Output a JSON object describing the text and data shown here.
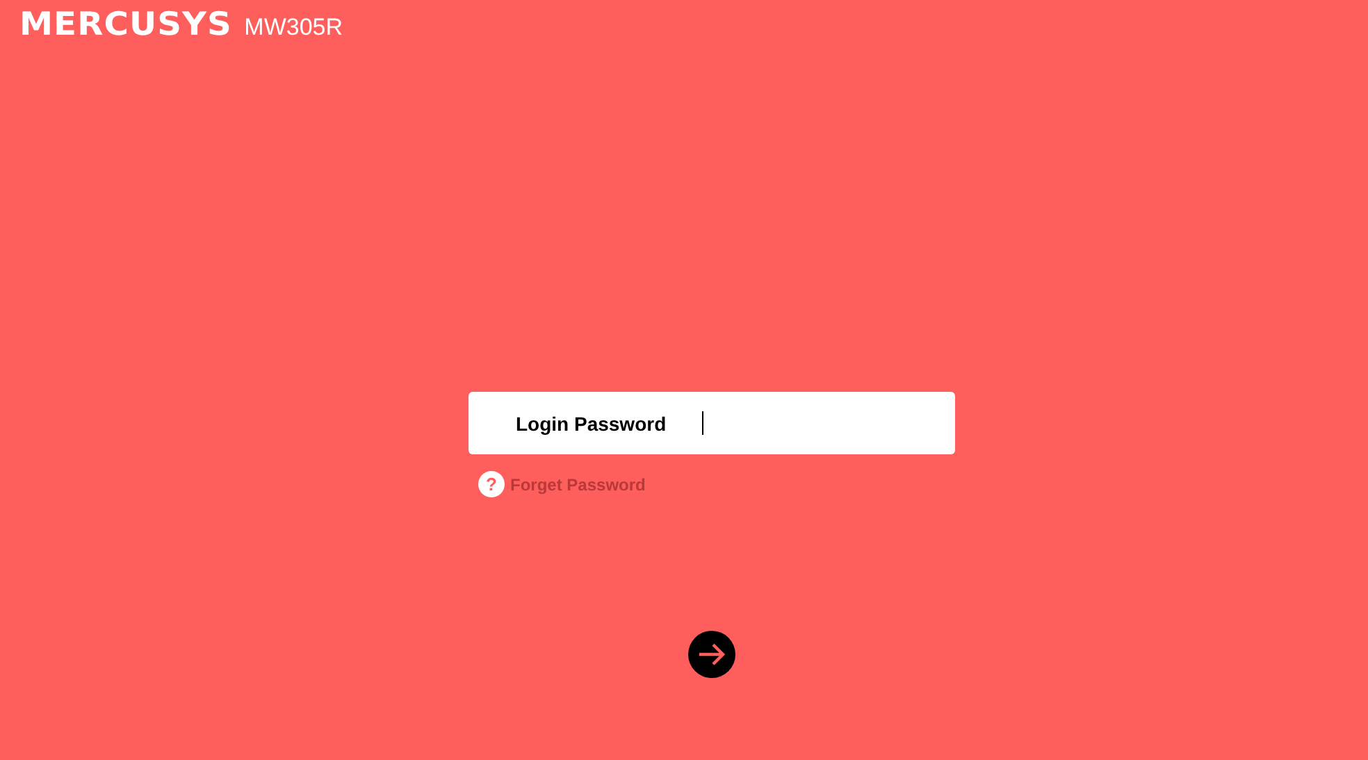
{
  "header": {
    "brand": "MERCUSYS",
    "model": "MW305R"
  },
  "login": {
    "label": "Login Password",
    "focused": true
  },
  "forget": {
    "icon": "?",
    "text": "Forget Password"
  }
}
